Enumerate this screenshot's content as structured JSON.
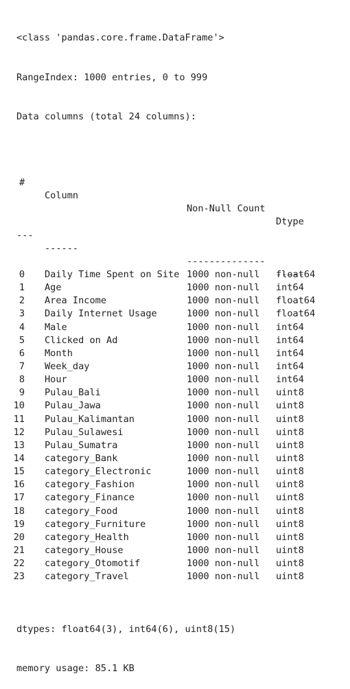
{
  "header": {
    "class_line": "<class 'pandas.core.frame.DataFrame'>",
    "range_index": "RangeIndex: 1000 entries, 0 to 999",
    "columns_summary": "Data columns (total 24 columns):"
  },
  "table": {
    "headers": {
      "index": "#",
      "column": "Column",
      "non_null": "Non-Null Count",
      "dtype": "Dtype"
    },
    "separators": {
      "index": "---",
      "column": "------",
      "non_null": "--------------",
      "dtype": "-----"
    },
    "rows": [
      {
        "index": "0",
        "column": "Daily Time Spent on Site",
        "non_null": "1000 non-null",
        "dtype": "float64"
      },
      {
        "index": "1",
        "column": "Age",
        "non_null": "1000 non-null",
        "dtype": "int64"
      },
      {
        "index": "2",
        "column": "Area Income",
        "non_null": "1000 non-null",
        "dtype": "float64"
      },
      {
        "index": "3",
        "column": "Daily Internet Usage",
        "non_null": "1000 non-null",
        "dtype": "float64"
      },
      {
        "index": "4",
        "column": "Male",
        "non_null": "1000 non-null",
        "dtype": "int64"
      },
      {
        "index": "5",
        "column": "Clicked on Ad",
        "non_null": "1000 non-null",
        "dtype": "int64"
      },
      {
        "index": "6",
        "column": "Month",
        "non_null": "1000 non-null",
        "dtype": "int64"
      },
      {
        "index": "7",
        "column": "Week_day",
        "non_null": "1000 non-null",
        "dtype": "int64"
      },
      {
        "index": "8",
        "column": "Hour",
        "non_null": "1000 non-null",
        "dtype": "int64"
      },
      {
        "index": "9",
        "column": "Pulau_Bali",
        "non_null": "1000 non-null",
        "dtype": "uint8"
      },
      {
        "index": "10",
        "column": "Pulau_Jawa",
        "non_null": "1000 non-null",
        "dtype": "uint8"
      },
      {
        "index": "11",
        "column": "Pulau_Kalimantan",
        "non_null": "1000 non-null",
        "dtype": "uint8"
      },
      {
        "index": "12",
        "column": "Pulau_Sulawesi",
        "non_null": "1000 non-null",
        "dtype": "uint8"
      },
      {
        "index": "13",
        "column": "Pulau_Sumatra",
        "non_null": "1000 non-null",
        "dtype": "uint8"
      },
      {
        "index": "14",
        "column": "category_Bank",
        "non_null": "1000 non-null",
        "dtype": "uint8"
      },
      {
        "index": "15",
        "column": "category_Electronic",
        "non_null": "1000 non-null",
        "dtype": "uint8"
      },
      {
        "index": "16",
        "column": "category_Fashion",
        "non_null": "1000 non-null",
        "dtype": "uint8"
      },
      {
        "index": "17",
        "column": "category_Finance",
        "non_null": "1000 non-null",
        "dtype": "uint8"
      },
      {
        "index": "18",
        "column": "category_Food",
        "non_null": "1000 non-null",
        "dtype": "uint8"
      },
      {
        "index": "19",
        "column": "category_Furniture",
        "non_null": "1000 non-null",
        "dtype": "uint8"
      },
      {
        "index": "20",
        "column": "category_Health",
        "non_null": "1000 non-null",
        "dtype": "uint8"
      },
      {
        "index": "21",
        "column": "category_House",
        "non_null": "1000 non-null",
        "dtype": "uint8"
      },
      {
        "index": "22",
        "column": "category_Otomotif",
        "non_null": "1000 non-null",
        "dtype": "uint8"
      },
      {
        "index": "23",
        "column": "category_Travel",
        "non_null": "1000 non-null",
        "dtype": "uint8"
      }
    ]
  },
  "footer": {
    "dtypes": "dtypes: float64(3), int64(6), uint8(15)",
    "memory": "memory usage: 85.1 KB"
  }
}
